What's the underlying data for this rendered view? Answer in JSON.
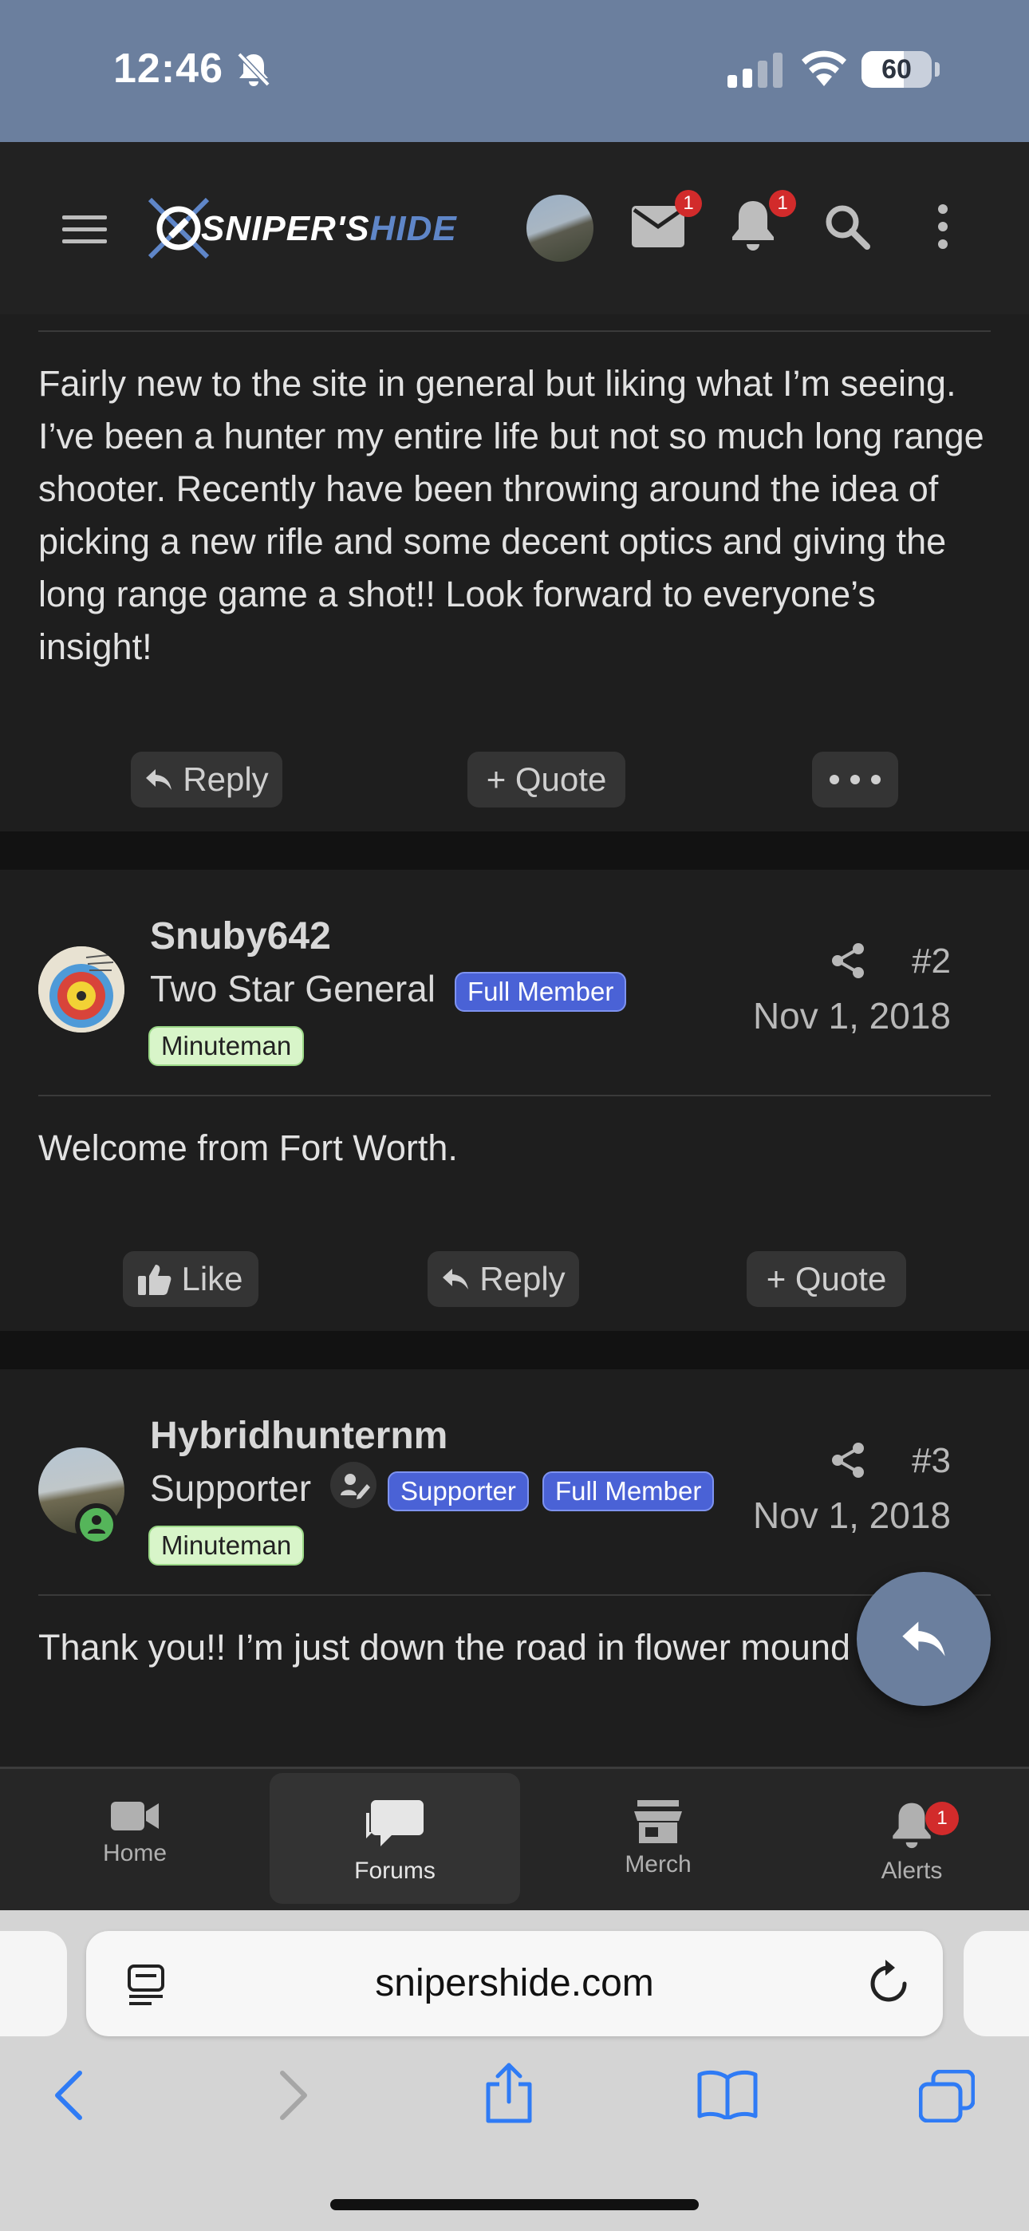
{
  "status_bar": {
    "time": "12:46",
    "battery_level": "60"
  },
  "header": {
    "logo_text_white": "SNIPER'S",
    "logo_text_blue": "HIDE",
    "mail_badge": "1",
    "alerts_badge": "1"
  },
  "posts": [
    {
      "body": "Fairly new to the site in general but liking what I’m seeing. I’ve been a hunter my entire life but not so much long range shooter. Recently have been throwing around the idea of picking a new rifle and some decent optics and giving the long range game a shot!! Look forward to everyone’s insight!",
      "actions": {
        "reply": "Reply",
        "quote": "+ Quote"
      }
    },
    {
      "username": "Snuby642",
      "user_title": "Two Star General",
      "banners": [
        "Full Member",
        "Minuteman"
      ],
      "post_number": "#2",
      "date": "Nov 1, 2018",
      "body": "Welcome from Fort Worth.",
      "actions": {
        "like": "Like",
        "reply": "Reply",
        "quote": "+ Quote"
      }
    },
    {
      "username": "Hybridhunternm",
      "user_title": "Supporter",
      "banners": [
        "Supporter",
        "Full Member",
        "Minuteman"
      ],
      "post_number": "#3",
      "date": "Nov 1, 2018",
      "body": "Thank you!! I’m just down the road in flower mound"
    }
  ],
  "tab_bar": {
    "tabs": [
      "Home",
      "Forums",
      "Merch",
      "Alerts"
    ],
    "active": "Forums",
    "alerts_badge": "1"
  },
  "browser": {
    "url": "snipershide.com"
  },
  "colors": {
    "status_bar": "#6b7f9e",
    "header_bg": "#222222",
    "post_bg": "#1e1e1e",
    "page_bg": "#121212",
    "badge_red": "#d22b2b",
    "banner_blue": "#4a62d6",
    "banner_green": "#d8f5c9",
    "ios_blue": "#2f7bf5"
  }
}
